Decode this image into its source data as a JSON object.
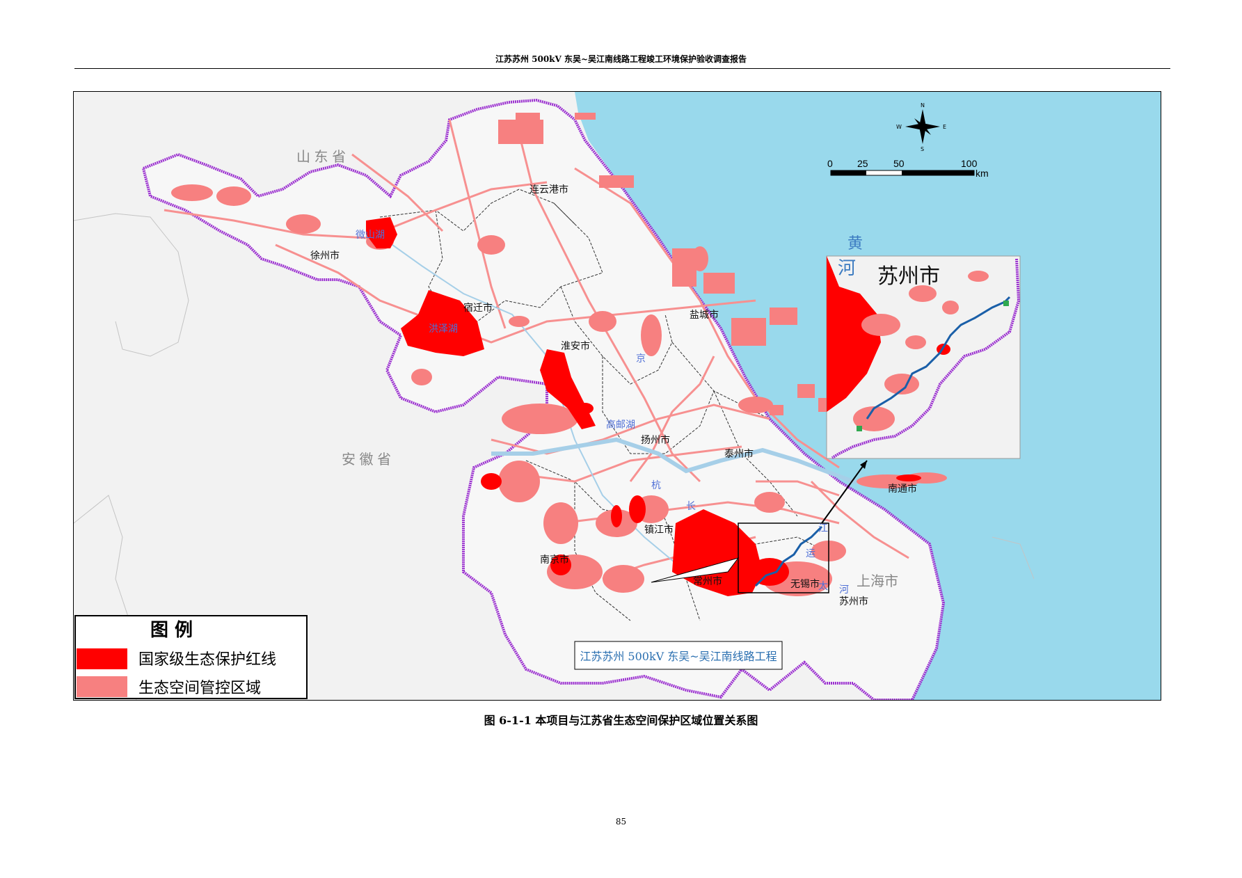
{
  "header": {
    "title": "江苏苏州 500kV 东吴~吴江南线路工程竣工环境保护验收调查报告"
  },
  "map": {
    "provinces": {
      "shandong": "山 东 省",
      "anhui": "安 徽 省",
      "shanghai": "上海市"
    },
    "sea": "黄",
    "cities": {
      "lianyungang": "连云港市",
      "xuzhou": "徐州市",
      "suqian": "宿迁市",
      "huaian": "淮安市",
      "yancheng": "盐城市",
      "yangzhou": "扬州市",
      "taizhou": "泰州市",
      "nantong": "南通市",
      "zhenjiang": "镇江市",
      "nanjing": "南京市",
      "changzhou": "常州市",
      "wuxi": "无锡市",
      "suzhou": "苏州市"
    },
    "lakes": {
      "weishan": "微山湖",
      "hongze": "洪泽湖",
      "gaoyou": "高邮湖",
      "tai": "太"
    },
    "river_chars": {
      "jing": "京",
      "hang": "杭",
      "yun": "运",
      "he": "河",
      "chang": "长",
      "jiang": "江"
    },
    "scale_bar": {
      "ticks": [
        "0",
        "25",
        "50",
        "100"
      ],
      "unit": "km"
    },
    "compass": {
      "n": "N",
      "s": "S",
      "e": "E",
      "w": "W"
    },
    "inset": {
      "title": "苏州市",
      "river_char": "河"
    },
    "project_label": "江苏苏州 500kV 东吴~吴江南线路工程",
    "legend": {
      "title": "图  例",
      "items": [
        {
          "label": "国家级生态保护红线",
          "color": "#ff0000"
        },
        {
          "label": "生态空间管控区域",
          "color": "#f78080"
        }
      ]
    },
    "colors": {
      "sea": "#99d9ec",
      "land": "#f2f2f2",
      "red_line": "#ff0000",
      "control_zone": "#f78080",
      "boundary": "#9b30d0",
      "route": "#1a5fa8"
    }
  },
  "caption": "图 6-1-1   本项目与江苏省生态空间保护区域位置关系图",
  "page_number": "85"
}
